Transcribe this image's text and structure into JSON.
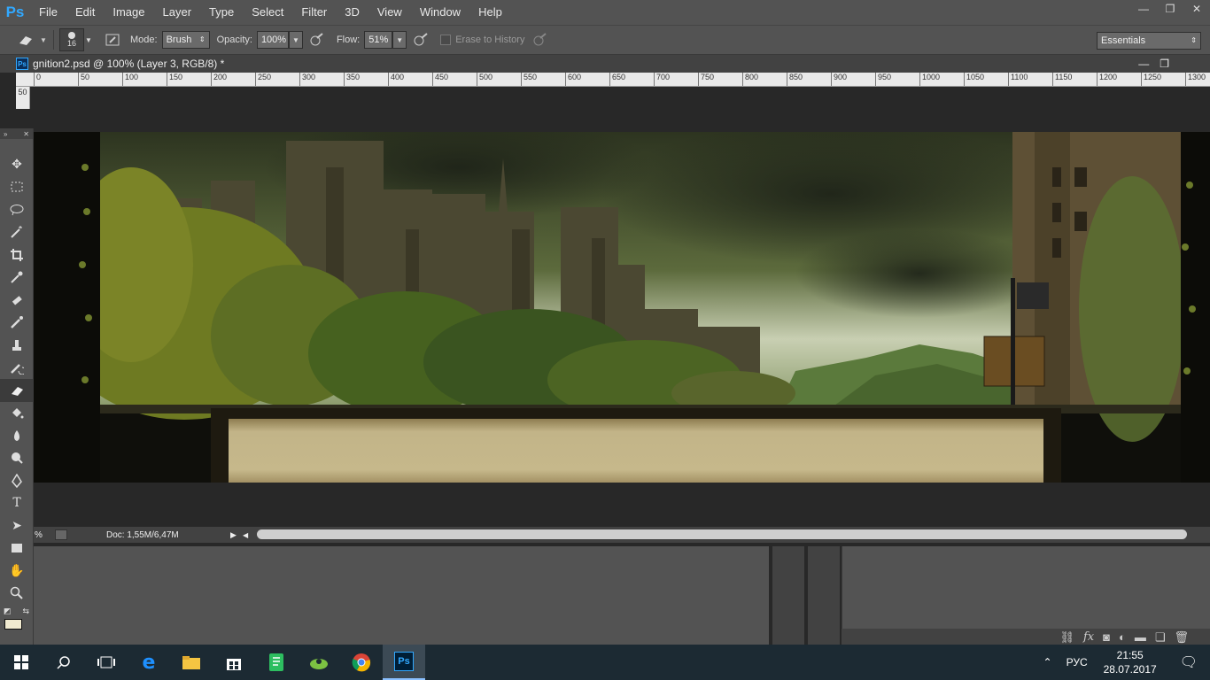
{
  "app": {
    "logo": "Ps",
    "window_buttons": [
      "—",
      "❐",
      "✕"
    ]
  },
  "menu": [
    "File",
    "Edit",
    "Image",
    "Layer",
    "Type",
    "Select",
    "Filter",
    "3D",
    "View",
    "Window",
    "Help"
  ],
  "options": {
    "brush_size": "16",
    "mode_label": "Mode:",
    "mode_value": "Brush",
    "opacity_label": "Opacity:",
    "opacity_value": "100%",
    "flow_label": "Flow:",
    "flow_value": "51%",
    "erase_history_label": "Erase to History",
    "workspace": "Essentials"
  },
  "document": {
    "tab_title": "gnition2.psd @ 100% (Layer 3, RGB/8) *",
    "tab_icon": "Ps",
    "doc_buttons": [
      "—",
      "❐"
    ]
  },
  "ruler": {
    "marks": [
      "0",
      "50",
      "100",
      "150",
      "200",
      "250",
      "300",
      "350",
      "400",
      "450",
      "500",
      "550",
      "600",
      "650",
      "700",
      "750",
      "800",
      "850",
      "900",
      "950",
      "1000",
      "1050",
      "1100",
      "1150",
      "1200",
      "1250",
      "1300"
    ],
    "vertical_label": "50"
  },
  "status": {
    "zoom": "%",
    "doc_info": "Doc: 1,55M/6,47M"
  },
  "taskbar": {
    "language": "РУС",
    "time": "21:55",
    "date": "28.07.2017",
    "ps_label": "Ps"
  },
  "colors": {
    "accent": "#31a8ff",
    "ui_bg": "#535353",
    "dark_bg": "#282828",
    "taskbar": "#1c2a33"
  }
}
